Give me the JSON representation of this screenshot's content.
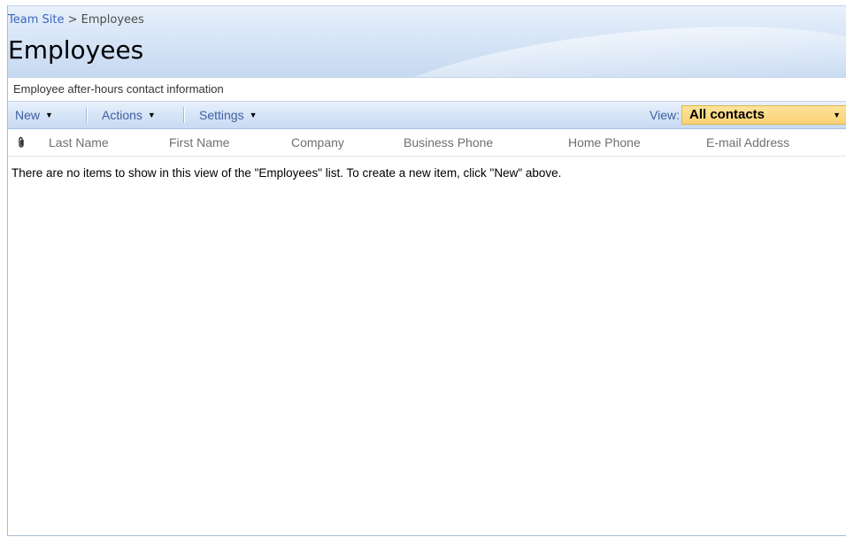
{
  "breadcrumb": {
    "site": "Team Site",
    "separator": " > ",
    "current": "Employees"
  },
  "page_title": "Employees",
  "description": "Employee after-hours contact information",
  "toolbar": {
    "new_label": "New",
    "actions_label": "Actions",
    "settings_label": "Settings",
    "view_label": "View:",
    "view_selected": "All contacts"
  },
  "columns": {
    "attachment_icon": "paperclip-icon",
    "last_name": "Last Name",
    "first_name": "First Name",
    "company": "Company",
    "business_phone": "Business Phone",
    "home_phone": "Home Phone",
    "email": "E-mail Address"
  },
  "empty_message": "There are no items to show in this view of the \"Employees\" list. To create a new item, click \"New\" above.",
  "colors": {
    "link": "#3966bf",
    "toolbar_text": "#3d5f9f",
    "view_select_bg": "#fbd275",
    "header_text": "#6f6f6f"
  }
}
